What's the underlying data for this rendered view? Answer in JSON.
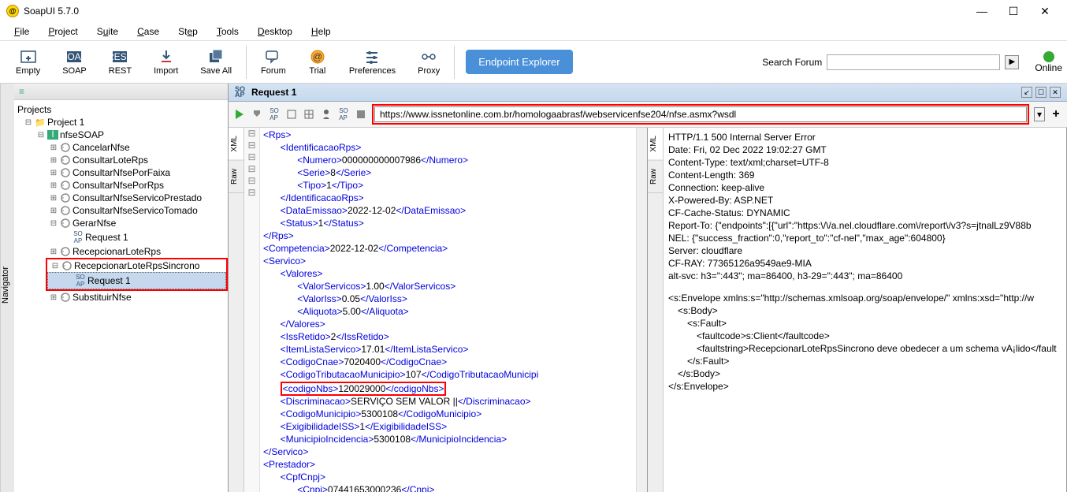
{
  "window": {
    "title": "SoapUI 5.7.0"
  },
  "menu": {
    "file": "File",
    "project": "Project",
    "suite": "Suite",
    "case": "Case",
    "step": "Step",
    "tools": "Tools",
    "desktop": "Desktop",
    "help": "Help"
  },
  "toolbar": {
    "empty": "Empty",
    "soap": "SOAP",
    "rest": "REST",
    "import": "Import",
    "saveall": "Save All",
    "forum": "Forum",
    "trial": "Trial",
    "preferences": "Preferences",
    "proxy": "Proxy",
    "endpoint_explorer": "Endpoint Explorer",
    "search_label": "Search Forum",
    "search_value": "",
    "online": "Online"
  },
  "navigator": {
    "side_label": "Navigator",
    "header": "Projects",
    "project": "Project 1",
    "iface": "nfseSOAP",
    "ops": [
      "CancelarNfse",
      "ConsultarLoteRps",
      "ConsultarNfsePorFaixa",
      "ConsultarNfsePorRps",
      "ConsultarNfseServicoPrestado",
      "ConsultarNfseServicoTomado",
      "GerarNfse"
    ],
    "gerar_req": "Request 1",
    "op_recepcionar": "RecepcionarLoteRps",
    "op_sincrono": "RecepcionarLoteRpsSincrono",
    "sincrono_req": "Request 1",
    "op_substituir": "SubstituirNfse"
  },
  "request": {
    "title": "Request 1",
    "url": "https://www.issnetonline.com.br/homologaabrasf/webservicenfse204/nfse.asmx?wsdl"
  },
  "xml": {
    "l1": "<Rps>",
    "l2o": "<IdentificacaoRps>",
    "l3": {
      "o": "<Numero>",
      "v": "000000000007986",
      "c": "</Numero>"
    },
    "l4": {
      "o": "<Serie>",
      "v": "8",
      "c": "</Serie>"
    },
    "l5": {
      "o": "<Tipo>",
      "v": "1",
      "c": "</Tipo>"
    },
    "l6": "</IdentificacaoRps>",
    "l7": {
      "o": "<DataEmissao>",
      "v": "2022-12-02",
      "c": "</DataEmissao>"
    },
    "l8": {
      "o": "<Status>",
      "v": "1",
      "c": "</Status>"
    },
    "l9": "</Rps>",
    "l10": {
      "o": "<Competencia>",
      "v": "2022-12-02",
      "c": "</Competencia>"
    },
    "l11": "<Servico>",
    "l12": "<Valores>",
    "l13": {
      "o": "<ValorServicos>",
      "v": "1.00",
      "c": "</ValorServicos>"
    },
    "l14": {
      "o": "<ValorIss>",
      "v": "0.05",
      "c": "</ValorIss>"
    },
    "l15": {
      "o": "<Aliquota>",
      "v": "5.00",
      "c": "</Aliquota>"
    },
    "l16": "</Valores>",
    "l17": {
      "o": "<IssRetido>",
      "v": "2",
      "c": "</IssRetido>"
    },
    "l18": {
      "o": "<ItemListaServico>",
      "v": "17.01",
      "c": "</ItemListaServico>"
    },
    "l19": {
      "o": "<CodigoCnae>",
      "v": "7020400",
      "c": "</CodigoCnae>"
    },
    "l20": {
      "o": "<CodigoTributacaoMunicipio>",
      "v": "107",
      "c": "</CodigoTributacaoMunicipi"
    },
    "l21": {
      "o": "<codigoNbs>",
      "v": "120029000",
      "c": "</codigoNbs>"
    },
    "l22": {
      "o": "<Discriminacao>",
      "v": "SERVIÇO SEM VALOR ||",
      "c": "</Discriminacao>"
    },
    "l23": {
      "o": "<CodigoMunicipio>",
      "v": "5300108",
      "c": "</CodigoMunicipio>"
    },
    "l24": {
      "o": "<ExigibilidadeISS>",
      "v": "1",
      "c": "</ExigibilidadeISS>"
    },
    "l25": {
      "o": "<MunicipioIncidencia>",
      "v": "5300108",
      "c": "</MunicipioIncidencia>"
    },
    "l26": "</Servico>",
    "l27": "<Prestador>",
    "l28": "<CpfCnpj>",
    "l29": {
      "o": "<Cnpj>",
      "v": "07441653000236",
      "c": "</Cnpj>"
    }
  },
  "response": {
    "h1": "HTTP/1.1 500 Internal Server Error",
    "h2": "Date: Fri, 02 Dec 2022 19:02:27 GMT",
    "h3": "Content-Type: text/xml;charset=UTF-8",
    "h4": "Content-Length: 369",
    "h5": "Connection: keep-alive",
    "h6": "X-Powered-By: ASP.NET",
    "h7": "CF-Cache-Status: DYNAMIC",
    "h8": "Report-To: {\"endpoints\":[{\"url\":\"https:\\/\\/a.nel.cloudflare.com\\/report\\/v3?s=jtnalLz9V88b",
    "h9": "NEL: {\"success_fraction\":0,\"report_to\":\"cf-nel\",\"max_age\":604800}",
    "h10": "Server: cloudflare",
    "h11": "CF-RAY: 77365126a9549ae9-MIA",
    "h12": "alt-svc: h3=\":443\"; ma=86400, h3-29=\":443\"; ma=86400",
    "env": "<s:Envelope xmlns:s=\"http://schemas.xmlsoap.org/soap/envelope/\" xmlns:xsd=\"http://w",
    "body_o": "<s:Body>",
    "fault_o": "<s:Fault>",
    "code": {
      "o": "<faultcode>",
      "v": "s:Client",
      "c": "</faultcode>"
    },
    "fs": {
      "o": "<faultstring>",
      "v": "RecepcionarLoteRpsSincrono deve obedecer a um schema vA¡lido",
      "c": "</fault"
    },
    "fault_c": "</s:Fault>",
    "body_c": "</s:Body>",
    "env_c": "</s:Envelope>"
  }
}
